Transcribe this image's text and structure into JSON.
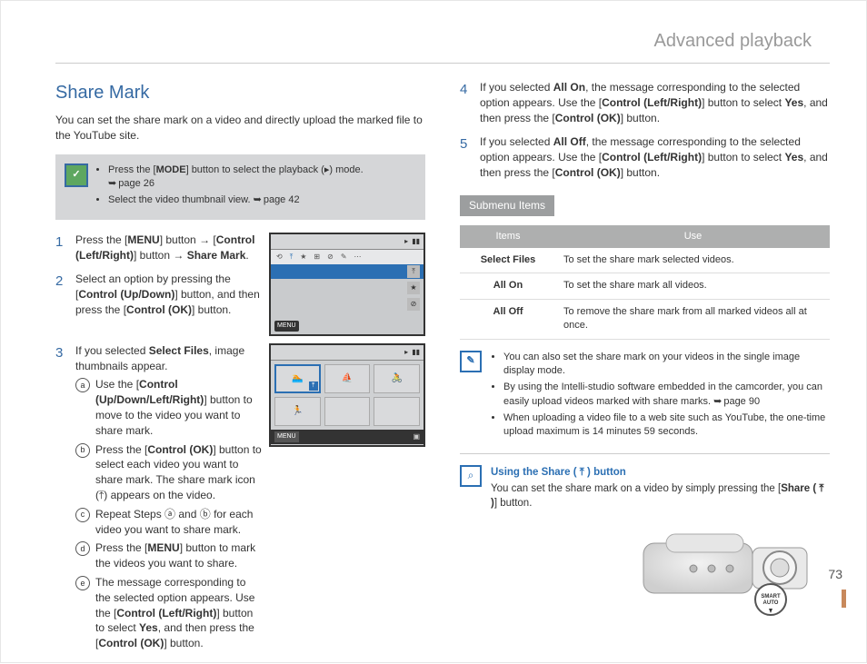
{
  "page_title": "Advanced playback",
  "page_number": "73",
  "left": {
    "section_title": "Share Mark",
    "intro": "You can set the share mark on a video and directly upload the marked file to the YouTube site.",
    "tips": {
      "item1_pre": "Press the [",
      "item1_bold": "MODE",
      "item1_post": "] button to select the playback (▸) mode.",
      "item1_ref": "page 26",
      "item2": "Select the video thumbnail view.",
      "item2_ref": "page 42"
    },
    "steps": {
      "s1": {
        "num": "1",
        "a1": "Press the [",
        "b1": "MENU",
        "a2": "] button → [",
        "b2": "Control (Left/Right)",
        "a3": "] button → ",
        "b3": "Share Mark",
        "a4": "."
      },
      "s2": {
        "num": "2",
        "a1": "Select an option by pressing the [",
        "b1": "Control (Up/Down)",
        "a2": "] button, and then press the [",
        "b2": "Control (OK)",
        "a3": "] button."
      },
      "s3": {
        "num": "3",
        "a1": "If you selected ",
        "b1": "Select Files",
        "a2": ", image thumbnails appear.",
        "sub": {
          "a": {
            "m": "a",
            "t1": "Use the [",
            "b1": "Control (Up/Down/Left/Right)",
            "t2": "] button to move to the video you want to share mark."
          },
          "b": {
            "m": "b",
            "t1": "Press the [",
            "b1": "Control (OK)",
            "t2": "] button to select each video you want to share mark. The share mark icon (⤒) appears on the video."
          },
          "c": {
            "m": "c",
            "t1": "Repeat Steps ⓐ and ⓑ for each video you want to share mark."
          },
          "d": {
            "m": "d",
            "t1": "Press the [",
            "b1": "MENU",
            "t2": "] button to mark the videos you want to share."
          },
          "e": {
            "m": "e",
            "t1": "The message corresponding to the selected option appears. Use the [",
            "b1": "Control (Left/Right)",
            "t2": "] button to select ",
            "b2": "Yes",
            "t3": ", and then press the [",
            "b3": "Control (OK)",
            "t4": "] button."
          }
        }
      }
    },
    "lcd1_menu_label": "MENU",
    "lcd2_menu_label": "MENU"
  },
  "right": {
    "steps": {
      "s4": {
        "num": "4",
        "a1": "If you selected ",
        "b1": "All On",
        "a2": ", the message corresponding to the selected option appears. Use the [",
        "b2": "Control (Left/Right)",
        "a3": "] button to select ",
        "b3": "Yes",
        "a4": ", and then press the [",
        "b4": "Control (OK)",
        "a5": "] button."
      },
      "s5": {
        "num": "5",
        "a1": "If you selected ",
        "b1": "All Off",
        "a2": ", the message corresponding to the selected option appears. Use the [",
        "b2": "Control (Left/Right)",
        "a3": "] button to select ",
        "b3": "Yes",
        "a4": ", and then press the [",
        "b4": "Control (OK)",
        "a5": "] button."
      }
    },
    "submenu_label": "Submenu Items",
    "table": {
      "h1": "Items",
      "h2": "Use",
      "r1k": "Select Files",
      "r1v": "To set the share mark selected videos.",
      "r2k": "All On",
      "r2v": "To set the share mark all videos.",
      "r3k": "All Off",
      "r3v": "To remove the share mark from all marked videos all at once."
    },
    "notes": {
      "n1": "You can also set the share mark on your videos in the single image display mode.",
      "n2": "By using the Intelli-studio software embedded in the camcorder, you can easily upload videos marked with share marks.",
      "n2_ref": "page 90",
      "n3": "When uploading a video file to a web site such as YouTube, the one-time upload maximum is 14 minutes 59 seconds."
    },
    "share": {
      "title": "Using the Share ( ⤒ ) button",
      "body_pre": "You can set the share mark on a video by simply pressing the [",
      "body_bold": "Share ( ⤒ )",
      "body_post": "] button."
    },
    "smart_auto_label": "SMART\nAUTO"
  }
}
